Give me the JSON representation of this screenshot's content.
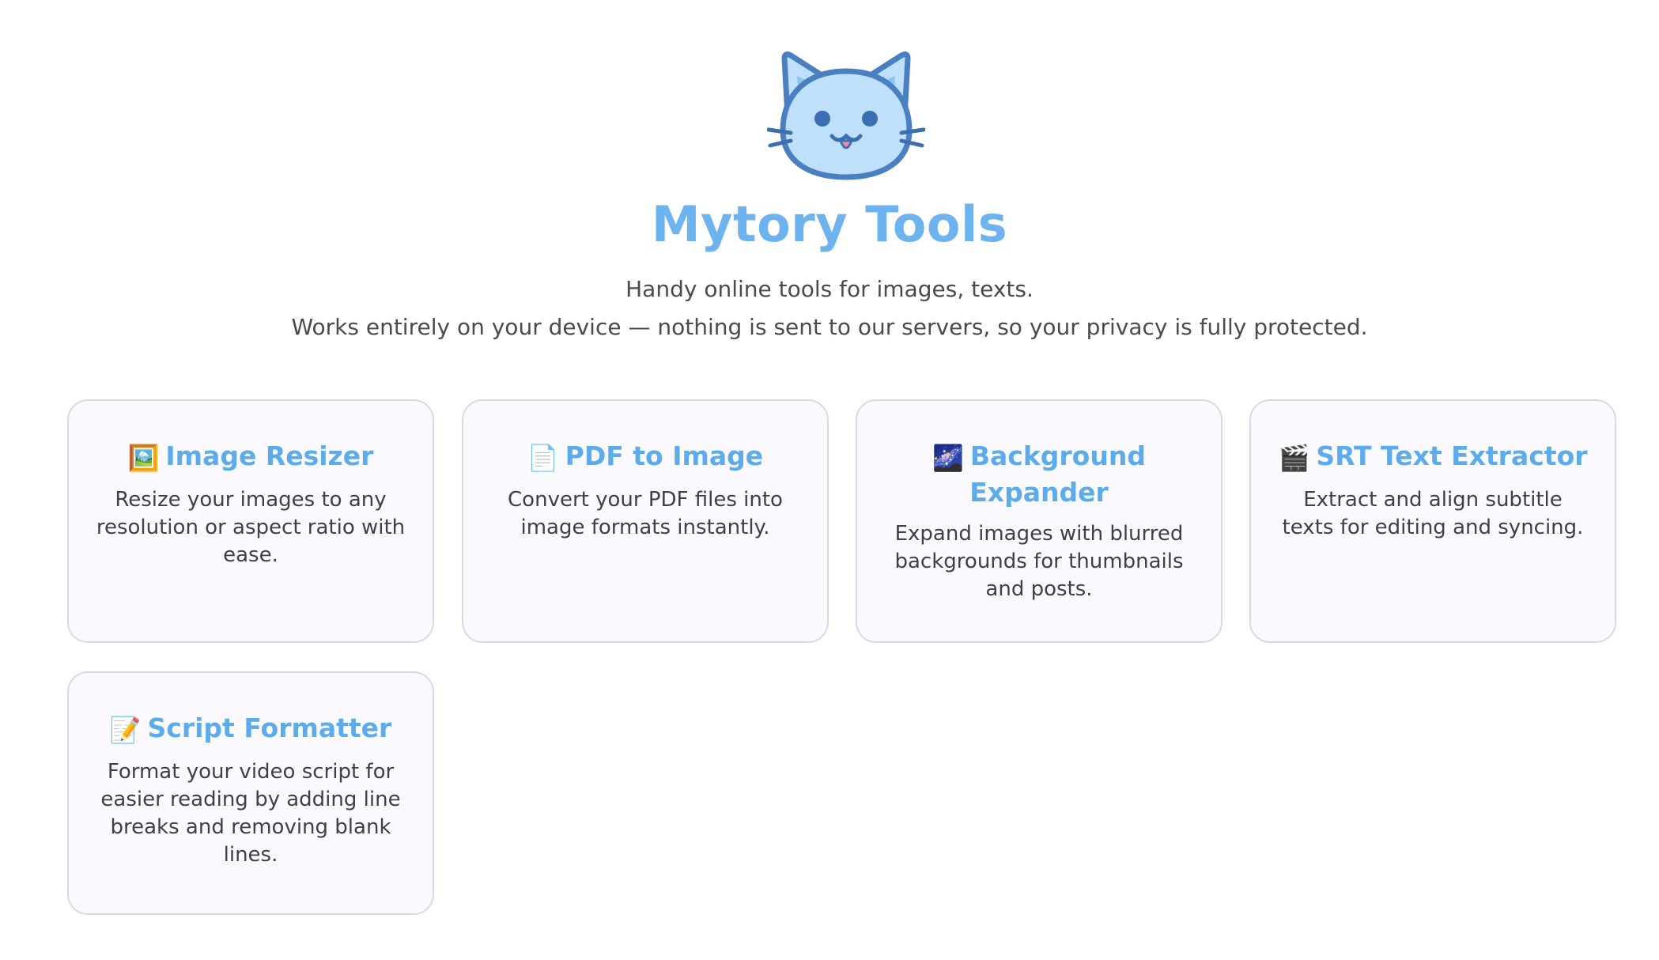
{
  "site": {
    "title": "Mytory Tools",
    "tagline_line1": "Handy online tools for images, texts.",
    "tagline_line2": "Works entirely on your device — nothing is sent to our servers, so your privacy is fully protected.",
    "logo_icon": "cat-face-icon"
  },
  "colors": {
    "accent": "#6cb3ef",
    "card_background": "#f9f9fe",
    "card_border": "#d9d9e6",
    "text": "#3f3f46"
  },
  "tools": [
    {
      "icon": "framed-picture-icon",
      "emoji": "🖼️",
      "title": "Image Resizer",
      "description": "Resize your images to any resolution or aspect ratio with ease."
    },
    {
      "icon": "page-facing-up-icon",
      "emoji": "📄",
      "title": "PDF to Image",
      "description": "Convert your PDF files into image formats instantly."
    },
    {
      "icon": "milky-way-icon",
      "emoji": "🌌",
      "title": "Background Expander",
      "description": "Expand images with blurred backgrounds for thumbnails and posts."
    },
    {
      "icon": "clapper-board-icon",
      "emoji": "🎬",
      "title": "SRT Text Extractor",
      "description": "Extract and align subtitle texts for editing and syncing."
    },
    {
      "icon": "memo-icon",
      "emoji": "📝",
      "title": "Script Formatter",
      "description": "Format your video script for easier reading by adding line breaks and removing blank lines."
    }
  ]
}
